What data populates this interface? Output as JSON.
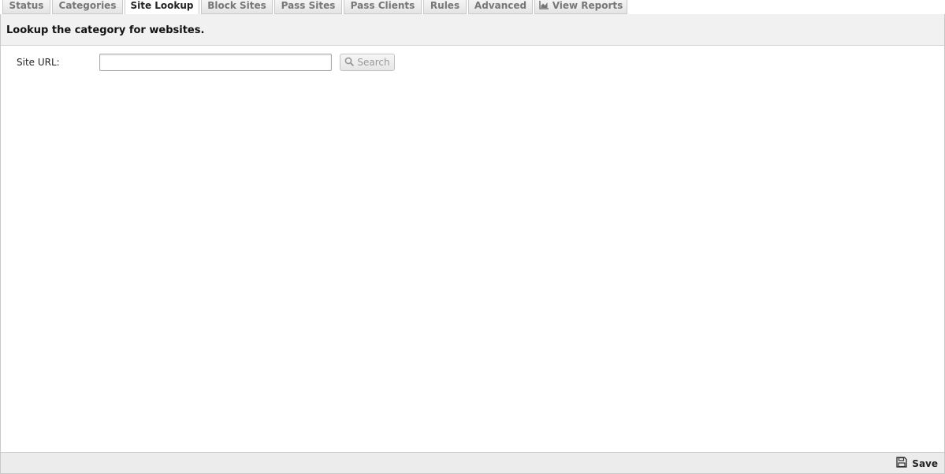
{
  "tabs": [
    {
      "label": "Status"
    },
    {
      "label": "Categories"
    },
    {
      "label": "Site Lookup",
      "active": true
    },
    {
      "label": "Block Sites"
    },
    {
      "label": "Pass Sites"
    },
    {
      "label": "Pass Clients"
    },
    {
      "label": "Rules"
    },
    {
      "label": "Advanced"
    },
    {
      "label": "View Reports",
      "icon": "chart-icon"
    }
  ],
  "panel": {
    "title": "Lookup the category for websites."
  },
  "form": {
    "site_url_label": "Site URL:",
    "site_url_value": "",
    "search_label": "Search",
    "search_icon": "search-icon"
  },
  "footer": {
    "save_label": "Save",
    "save_icon": "save-icon"
  },
  "colors": {
    "tab_bg": "#e9e9e9",
    "tab_active_bg": "#ffffff",
    "header_bg": "#f1f1f1",
    "footer_bg": "#ececec",
    "border": "#c9c9c9"
  }
}
